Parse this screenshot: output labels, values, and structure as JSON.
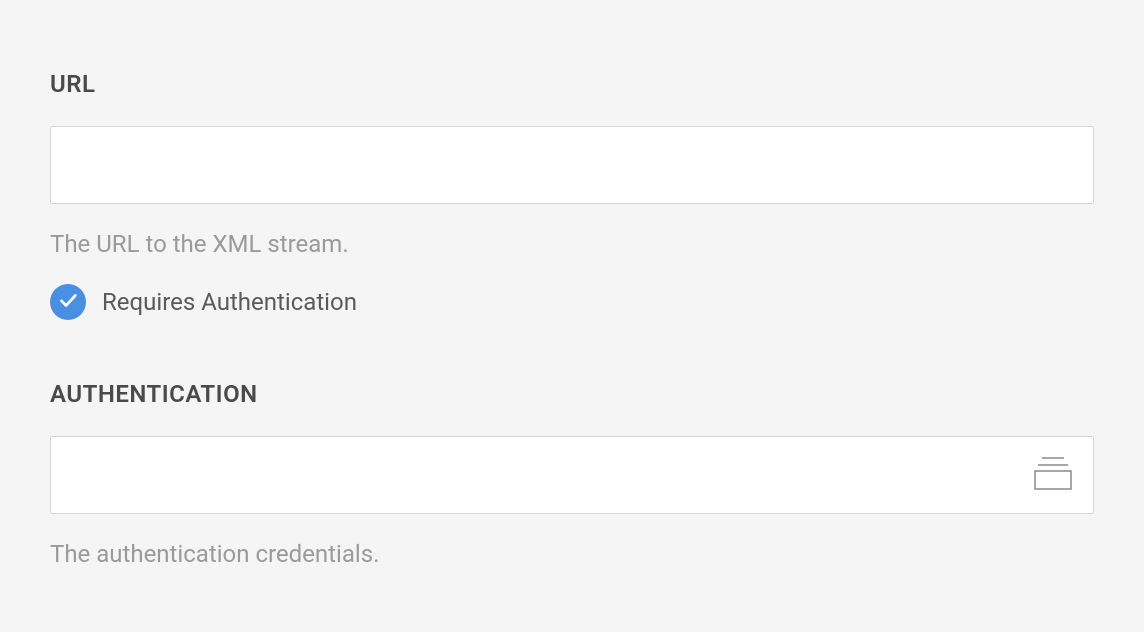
{
  "url_section": {
    "label": "URL",
    "value": "",
    "help_text": "The URL to the XML stream."
  },
  "requires_auth": {
    "checked": true,
    "label": "Requires Authentication"
  },
  "auth_section": {
    "label": "AUTHENTICATION",
    "value": "",
    "help_text": "The authentication credentials."
  }
}
